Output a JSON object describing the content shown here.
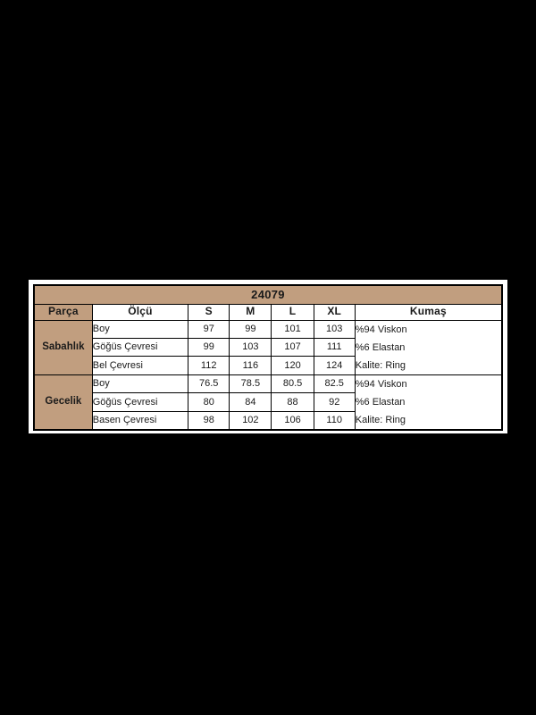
{
  "page": {
    "background_color": "#000000",
    "frame_color": "#ffffff"
  },
  "size_chart": {
    "title": "24079",
    "accent_color": "#c19e7f",
    "border_color": "#000000",
    "headers": {
      "part": "Parça",
      "measure": "Ölçü",
      "s": "S",
      "m": "M",
      "l": "L",
      "xl": "XL",
      "fabric": "Kumaş"
    },
    "groups": [
      {
        "name": "Sabahlık",
        "rows": [
          {
            "measure": "Boy",
            "s": "97",
            "m": "99",
            "l": "101",
            "xl": "103"
          },
          {
            "measure": "Göğüs Çevresi",
            "s": "99",
            "m": "103",
            "l": "107",
            "xl": "111"
          },
          {
            "measure": "Bel Çevresi",
            "s": "112",
            "m": "116",
            "l": "120",
            "xl": "124"
          }
        ],
        "fabric": [
          "%94 Viskon",
          "%6 Elastan",
          "Kalite: Ring"
        ]
      },
      {
        "name": "Gecelik",
        "rows": [
          {
            "measure": "Boy",
            "s": "76.5",
            "m": "78.5",
            "l": "80.5",
            "xl": "82.5"
          },
          {
            "measure": "Göğüs Çevresi",
            "s": "80",
            "m": "84",
            "l": "88",
            "xl": "92"
          },
          {
            "measure": "Basen Çevresi",
            "s": "98",
            "m": "102",
            "l": "106",
            "xl": "110"
          }
        ],
        "fabric": [
          "%94 Viskon",
          "%6 Elastan",
          "Kalite: Ring"
        ]
      }
    ]
  }
}
